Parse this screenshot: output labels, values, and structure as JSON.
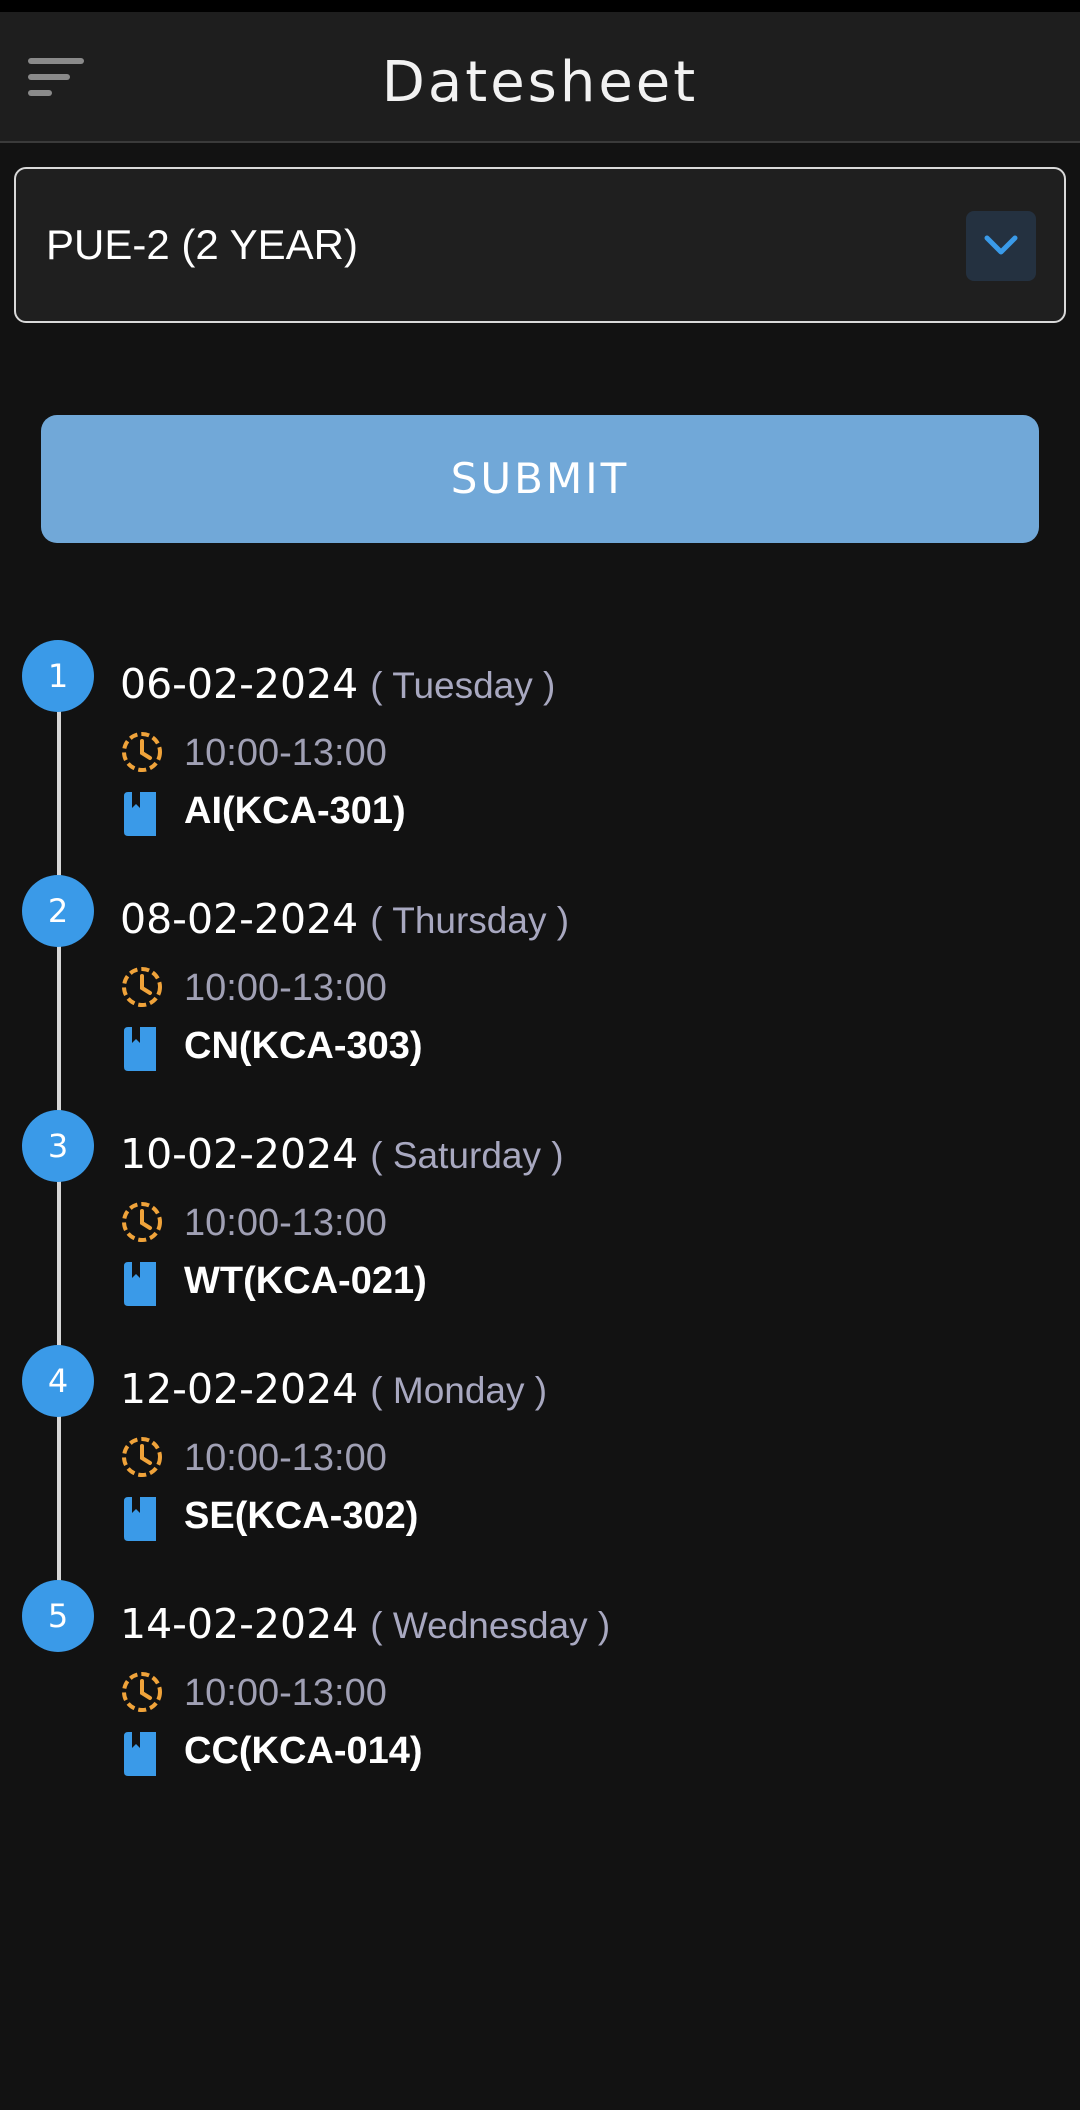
{
  "app_bar": {
    "title": "Datesheet",
    "menu_icon": "menu-icon"
  },
  "course_select": {
    "value": "PUE-2 (2 YEAR)",
    "arrow_icon": "chevron-down-icon"
  },
  "submit_label": "SUBMIT",
  "colors": {
    "accent_blue": "#3a9ae8",
    "button_blue": "#71a8d8",
    "clock_orange": "#f0a33a",
    "background": "#121212"
  },
  "exams": [
    {
      "index": "1",
      "date": "06-02-2024",
      "day": "( Tuesday )",
      "time": "10:00-13:00",
      "subject": "AI(KCA-301)"
    },
    {
      "index": "2",
      "date": "08-02-2024",
      "day": "( Thursday )",
      "time": "10:00-13:00",
      "subject": "CN(KCA-303)"
    },
    {
      "index": "3",
      "date": "10-02-2024",
      "day": "( Saturday )",
      "time": "10:00-13:00",
      "subject": "WT(KCA-021)"
    },
    {
      "index": "4",
      "date": "12-02-2024",
      "day": "( Monday )",
      "time": "10:00-13:00",
      "subject": "SE(KCA-302)"
    },
    {
      "index": "5",
      "date": "14-02-2024",
      "day": "( Wednesday )",
      "time": "10:00-13:00",
      "subject": "CC(KCA-014)"
    }
  ]
}
